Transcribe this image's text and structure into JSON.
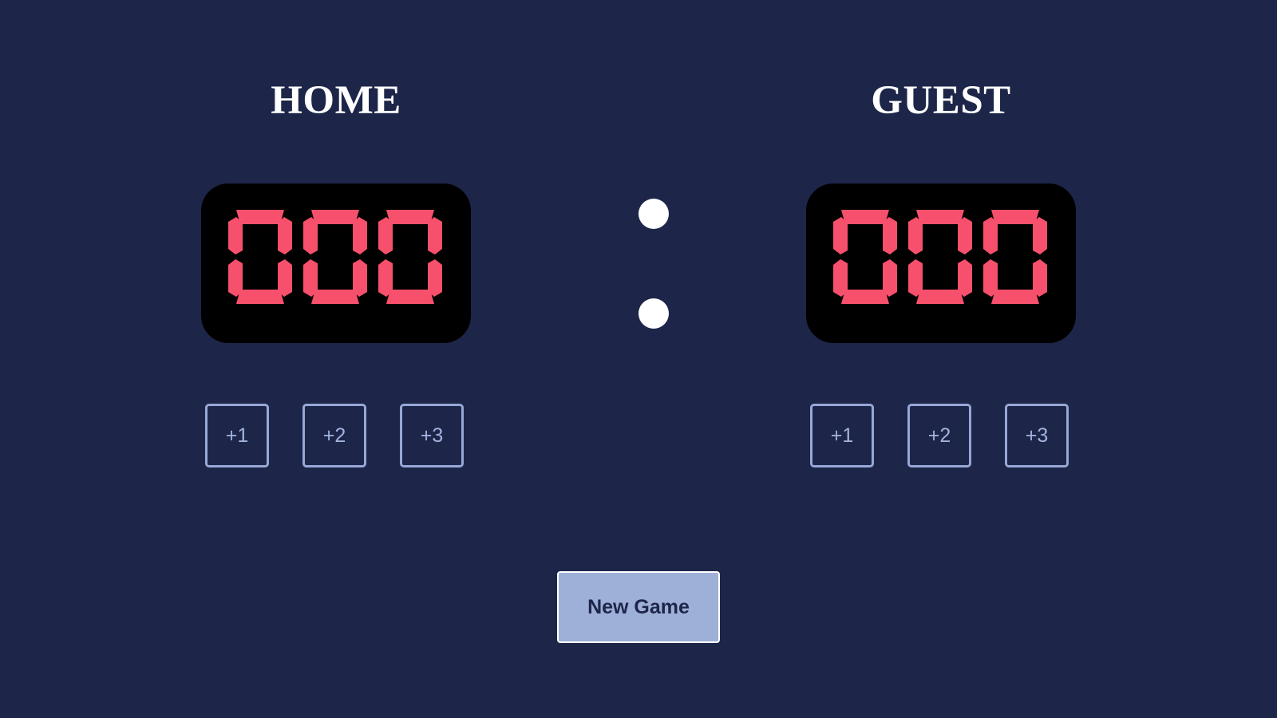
{
  "home": {
    "title": "HOME",
    "score": "000",
    "buttons": [
      "+1",
      "+2",
      "+3"
    ]
  },
  "guest": {
    "title": "GUEST",
    "score": "000",
    "buttons": [
      "+1",
      "+2",
      "+3"
    ]
  },
  "new_game_label": "New Game",
  "colors": {
    "background": "#1d2649",
    "display": "#000000",
    "digits": "#f7506c",
    "button_border": "#97a7d6",
    "new_game_bg": "#9eafd8"
  }
}
